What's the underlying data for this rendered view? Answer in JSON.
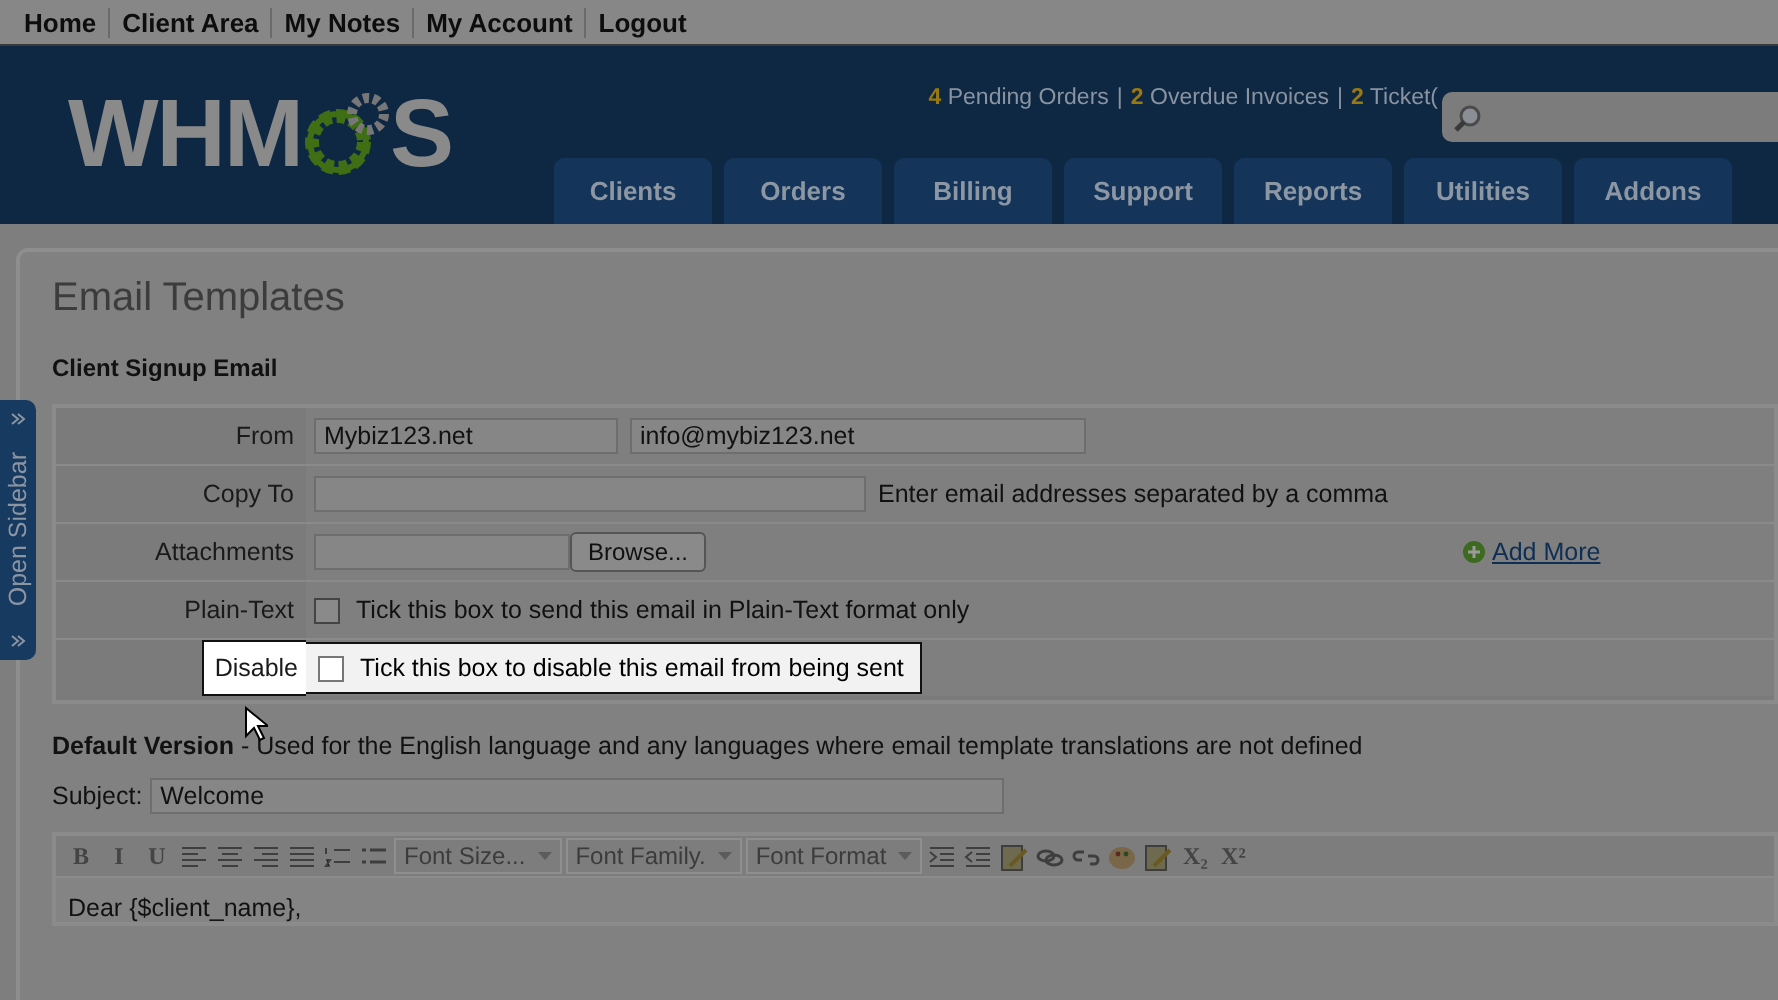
{
  "top_links": [
    "Home",
    "Client Area",
    "My Notes",
    "My Account",
    "Logout"
  ],
  "header": {
    "logo_left": "WHM",
    "logo_right": "S",
    "separator": "|",
    "stats": [
      {
        "count": "4",
        "label": "Pending Orders"
      },
      {
        "count": "2",
        "label": "Overdue Invoices"
      },
      {
        "count": "2",
        "label": "Ticket("
      }
    ],
    "nav_tabs": [
      "Clients",
      "Orders",
      "Billing",
      "Support",
      "Reports",
      "Utilities",
      "Addons"
    ]
  },
  "sidebar_toggle": "Open Sidebar",
  "page_title": "Email Templates",
  "section_title": "Client Signup Email",
  "form": [
    {
      "kind": "pair",
      "label": "From",
      "values": [
        "Mybiz123.net",
        "info@mybiz123.net"
      ]
    },
    {
      "kind": "text",
      "label": "Copy To",
      "hint": "Enter email addresses separated by a comma"
    },
    {
      "kind": "file",
      "label": "Attachments",
      "button": "Browse...",
      "add_more": "Add More"
    },
    {
      "kind": "checkbox",
      "label": "Plain-Text",
      "text": "Tick this box to send this email in Plain-Text format only",
      "checked": false,
      "highlighted": false
    },
    {
      "kind": "checkbox",
      "label": "Disable",
      "text": "Tick this box to disable this email from being sent",
      "checked": false,
      "highlighted": true
    }
  ],
  "version_note": "**Default Version** - Used for the English language and any languages where email template translations are not defined",
  "subject": {
    "label": "Subject:",
    "value": "Welcome"
  },
  "toolbar": [
    {
      "kind": "glyph",
      "text": "B"
    },
    {
      "kind": "glyph",
      "text": "I"
    },
    {
      "kind": "glyph",
      "text": "U"
    },
    {
      "kind": "left"
    },
    {
      "kind": "center"
    },
    {
      "kind": "right"
    },
    {
      "kind": "justify"
    },
    {
      "kind": "numbers"
    },
    {
      "kind": "bullets"
    },
    {
      "kind": "dropdown",
      "text": "Font Size..."
    },
    {
      "kind": "dropdown",
      "text": "Font Family."
    },
    {
      "kind": "dropdown",
      "text": "Font Format"
    },
    {
      "kind": "indent"
    },
    {
      "kind": "outdent"
    },
    {
      "kind": "edit"
    },
    {
      "kind": "link"
    },
    {
      "kind": "unlink"
    },
    {
      "kind": "palette"
    },
    {
      "kind": "edit"
    },
    {
      "kind": "glyph",
      "text": "X₂"
    },
    {
      "kind": "glyph",
      "text": "X²"
    }
  ],
  "editor_body": "Dear {$client_name},"
}
